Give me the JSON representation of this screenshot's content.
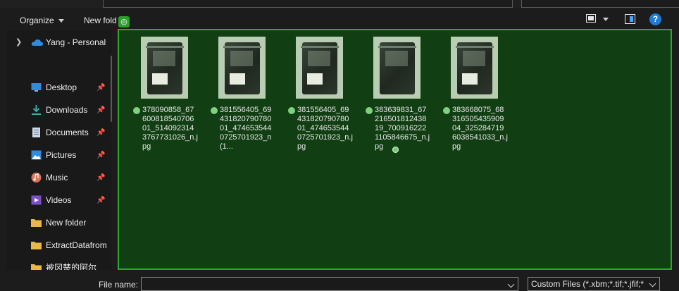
{
  "toolbar": {
    "organize_label": "Organize",
    "new_folder_label": "New fold"
  },
  "nav": {
    "account_label": "Yang - Personal",
    "items": [
      {
        "label": "Desktop",
        "icon": "desktop-icon"
      },
      {
        "label": "Downloads",
        "icon": "downloads-icon"
      },
      {
        "label": "Documents",
        "icon": "documents-icon"
      },
      {
        "label": "Pictures",
        "icon": "pictures-icon"
      },
      {
        "label": "Music",
        "icon": "music-icon"
      },
      {
        "label": "Videos",
        "icon": "videos-icon"
      },
      {
        "label": "New folder",
        "icon": "folder-icon"
      },
      {
        "label": "ExtractDatafrom",
        "icon": "folder-icon"
      },
      {
        "label": "被冈楚的阿尔",
        "icon": "folder-icon"
      }
    ]
  },
  "files": [
    {
      "name": "378090858_6760081854070601_5140923143767731026_n.jpg"
    },
    {
      "name": "381556405_6943182079078001_4746535440725701923_n (1..."
    },
    {
      "name": "381556405_6943182079078001_4746535440725701923_n.jpg"
    },
    {
      "name": "383639831_6721650181243819_7009162221105846675_n.jpg"
    },
    {
      "name": "383668075_6831650543590904_3252847196038541033_n.jpg"
    }
  ],
  "footer": {
    "filename_label": "File name:",
    "filename_value": "",
    "filetype_value": "Custom Files (*.xbm;*.tif;*.jfif;*"
  },
  "colors": {
    "drop_fill": "#113f13",
    "drop_border": "#2fa52f",
    "accent": "#1f7ad6"
  }
}
